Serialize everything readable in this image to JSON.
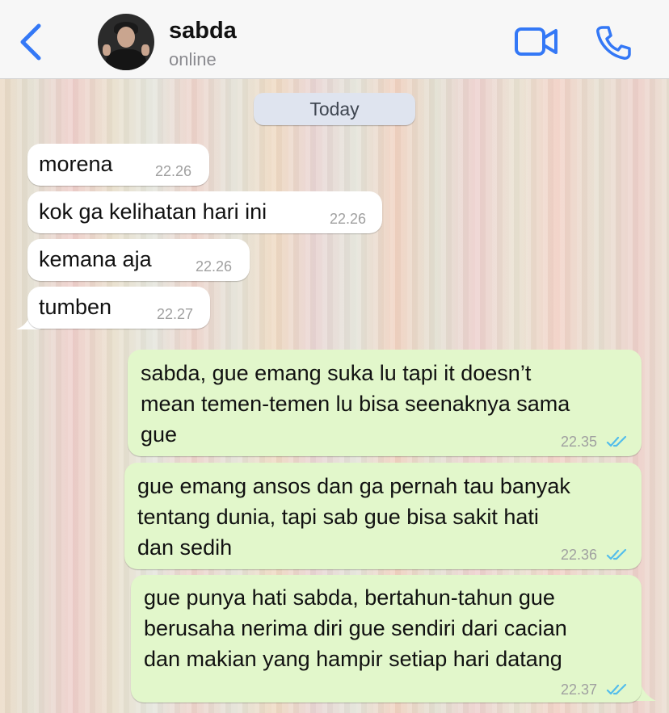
{
  "header": {
    "back_icon": "chevron-left-icon",
    "contact_name": "sabda",
    "contact_status": "online",
    "video_icon": "video-camera-icon",
    "call_icon": "phone-icon",
    "accent_color": "#3478f6"
  },
  "chat": {
    "date_label": "Today",
    "messages": [
      {
        "direction": "incoming",
        "lines": [
          "morena"
        ],
        "time": "22.26"
      },
      {
        "direction": "incoming",
        "lines": [
          "kok ga kelihatan hari ini"
        ],
        "time": "22.26"
      },
      {
        "direction": "incoming",
        "lines": [
          "kemana aja"
        ],
        "time": "22.26"
      },
      {
        "direction": "incoming",
        "lines": [
          "tumben"
        ],
        "time": "22.27"
      },
      {
        "direction": "outgoing",
        "lines": [
          "sabda, gue emang suka lu tapi it doesn’t",
          "mean temen-temen lu bisa seenaknya sama",
          "gue"
        ],
        "time": "22.35",
        "status": "read"
      },
      {
        "direction": "outgoing",
        "lines": [
          "gue emang ansos dan ga pernah tau banyak",
          "tentang dunia, tapi sab gue bisa sakit hati",
          "dan sedih"
        ],
        "time": "22.36",
        "status": "read"
      },
      {
        "direction": "outgoing",
        "lines": [
          "gue punya hati sabda, bertahun-tahun gue",
          "berusaha nerima diri gue sendiri dari cacian",
          "dan makian yang hampir setiap hari datang"
        ],
        "time": "22.37",
        "status": "read"
      }
    ],
    "read_tick_color": "#53bdeb"
  }
}
